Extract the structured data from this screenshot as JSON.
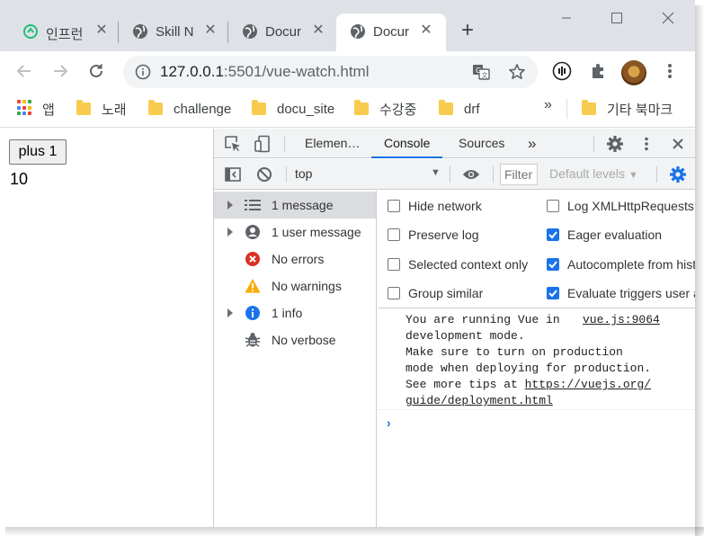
{
  "tabs": [
    {
      "title": "인프런",
      "icon": "inflearn-favicon",
      "active": false
    },
    {
      "title": "Skill N",
      "icon": "globe-icon",
      "active": false
    },
    {
      "title": "Docur",
      "icon": "globe-icon",
      "active": false
    },
    {
      "title": "Docur",
      "icon": "globe-icon",
      "active": true
    }
  ],
  "new_tab_label": "+",
  "address": {
    "host": "127.0.0.1",
    "port": ":5501",
    "path": "/vue-watch.html"
  },
  "bookmarks": {
    "apps_label": "앱",
    "items": [
      "노래",
      "challenge",
      "docu_site",
      "수강중",
      "drf"
    ],
    "more": "»",
    "other": "기타 북마크"
  },
  "page": {
    "button_label": "plus 1",
    "counter_value": "10"
  },
  "devtools": {
    "tabs": [
      "Elemen…",
      "Console",
      "Sources"
    ],
    "active_tab": "Console",
    "more_tabs": "»",
    "context": "top",
    "filter_placeholder": "Filter",
    "default_levels": "Default levels",
    "sidebar": [
      {
        "label": "1 message",
        "icon": "list-icon",
        "expandable": true,
        "selected": true
      },
      {
        "label": "1 user message",
        "icon": "user-icon",
        "expandable": true,
        "selected": false
      },
      {
        "label": "No errors",
        "icon": "error-icon",
        "expandable": false,
        "selected": false
      },
      {
        "label": "No warnings",
        "icon": "warning-icon",
        "expandable": false,
        "selected": false
      },
      {
        "label": "1 info",
        "icon": "info-icon",
        "expandable": true,
        "selected": false
      },
      {
        "label": "No verbose",
        "icon": "bug-icon",
        "expandable": false,
        "selected": false
      }
    ],
    "settings": [
      {
        "label": "Hide network",
        "checked": false
      },
      {
        "label": "Log XMLHttpRequests",
        "checked": false
      },
      {
        "label": "Preserve log",
        "checked": false
      },
      {
        "label": "Eager evaluation",
        "checked": true
      },
      {
        "label": "Selected context only",
        "checked": false
      },
      {
        "label": "Autocomplete from history",
        "checked": true
      },
      {
        "label": "Group similar",
        "checked": false
      },
      {
        "label": "Evaluate triggers user activation",
        "checked": true
      }
    ],
    "message": {
      "lines": [
        "You are running Vue in",
        "development mode.",
        "Make sure to turn on production",
        "mode when deploying for production.",
        "See more tips at "
      ],
      "link": "https://vuejs.org/",
      "link_cont": "guide/deployment.html",
      "source": "vue.js:9064"
    },
    "prompt": "›"
  },
  "colors": {
    "accent": "#1a73e8",
    "error": "#d93025",
    "warning": "#f9ab00",
    "info_icon": "#1a73e8"
  }
}
